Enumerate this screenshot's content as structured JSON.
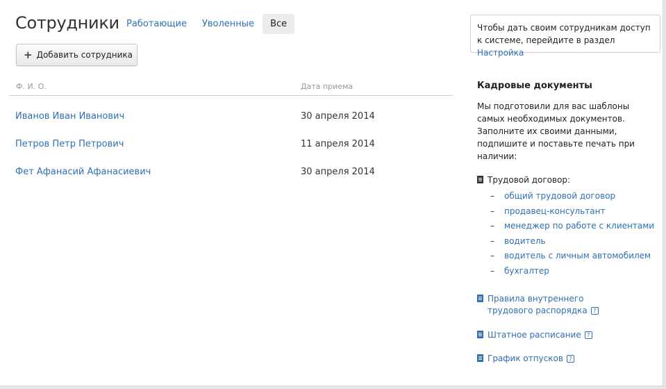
{
  "header": {
    "title": "Сотрудники",
    "tabs": [
      {
        "label": "Работающие",
        "active": false
      },
      {
        "label": "Уволенные",
        "active": false
      },
      {
        "label": "Все",
        "active": true
      }
    ],
    "add_button_label": "Добавить сотрудника"
  },
  "table": {
    "columns": [
      "Ф. И. О.",
      "Дата приема"
    ],
    "rows": [
      {
        "name": "Иванов Иван Иванович",
        "date": "30 апреля 2014"
      },
      {
        "name": "Петров Петр Петрович",
        "date": "11 апреля 2014"
      },
      {
        "name": "Фет Афанасий Афанасиевич",
        "date": "30 апреля 2014"
      }
    ]
  },
  "info": {
    "text": "Чтобы дать своим сотрудникам доступ к системе, перейдите в раздел ",
    "link": "Настройка"
  },
  "documents": {
    "title": "Кадровые документы",
    "description": "Мы подготовили для вас шаблоны самых необходимых документов. Заполните их своими данными, подпишите и поставьте печать при наличии:",
    "contract_title": "Трудовой договор:",
    "contract_dash": "–",
    "contracts": [
      "общий трудовой договор",
      "продавец-консультант",
      "менеджер по работе с клиентами",
      "водитель",
      "водитель с личным автомобилем",
      "бухгалтер"
    ],
    "help_mark": "?",
    "rules_line1": "Правила внутреннего",
    "rules_line2": "трудового распорядка",
    "staffing": "Штатное расписание",
    "vacations": "График отпусков"
  },
  "colors": {
    "link": "#2f6fb5",
    "text": "#222222",
    "muted": "#999999"
  }
}
